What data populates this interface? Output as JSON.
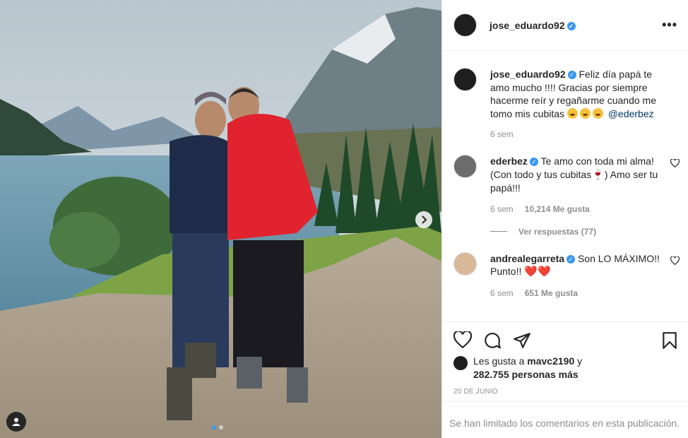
{
  "post": {
    "username": "jose_eduardo92",
    "caption": "Feliz día papá te amo mucho !!!! Gracias por siempre hacerme reír y regañarme cuando me tomo mis cubitas",
    "caption_mention": "@ederbez",
    "caption_time": "6 sem",
    "liked_by_prefix": "Les gusta a",
    "liked_by_user": "mavc2190",
    "liked_by_connector": "y",
    "liked_by_others": "282.755 personas más",
    "date": "20 DE JUNIO",
    "comments_limited": "Se han limitado los comentarios en esta publicación."
  },
  "comments": [
    {
      "username": "ederbez",
      "text": "Te amo con toda mi alma! (Con todo y tus cubitas",
      "text_end": ") Amo ser tu papá!!!",
      "time": "6 sem",
      "likes": "10,214 Me gusta",
      "replies": "Ver respuestas (77)"
    },
    {
      "username": "andrealegarreta",
      "text": "Son LO MÁXIMO!! Punto!!",
      "time": "6 sem",
      "likes": "651 Me gusta"
    }
  ],
  "icons": {
    "verified": "verified-badge-icon",
    "more": "more-options-icon",
    "like": "heart-icon",
    "comment": "comment-icon",
    "share": "share-icon",
    "save": "bookmark-icon",
    "next": "chevron-right-icon",
    "user_tag": "user-tag-icon"
  },
  "carousel": {
    "total": 2,
    "current": 1
  },
  "colors": {
    "accent": "#3897f0",
    "heart": "#ed4956",
    "muted": "#8e8e8e"
  }
}
